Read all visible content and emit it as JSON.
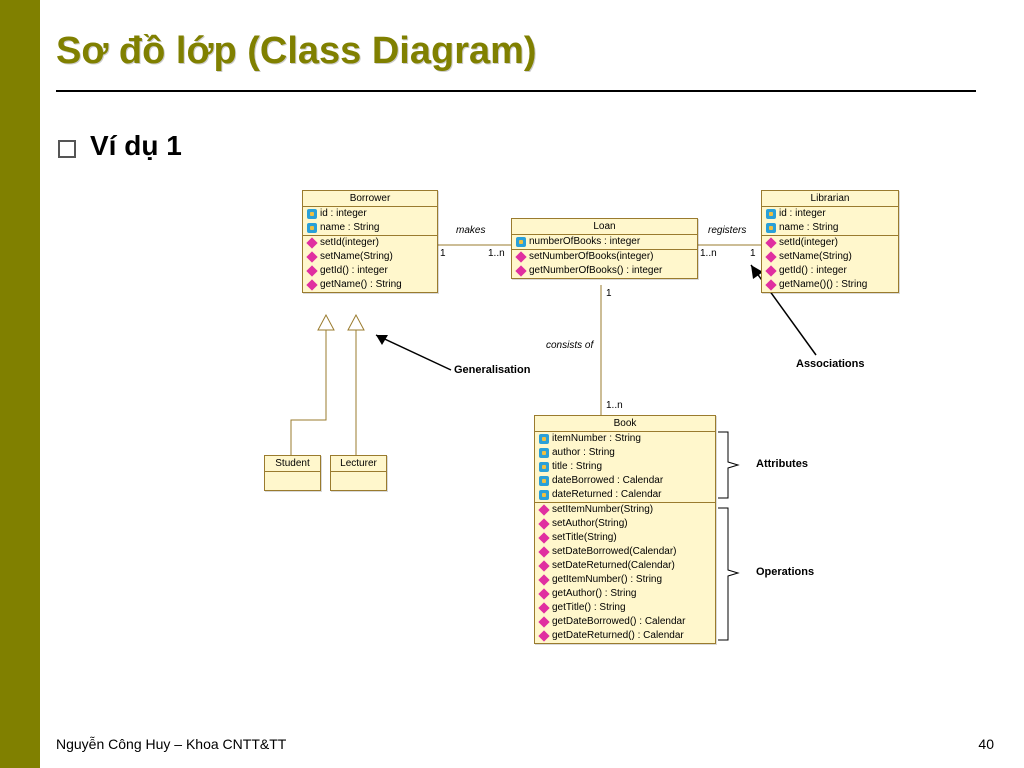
{
  "slide": {
    "title": "Sơ đồ lớp (Class Diagram)",
    "subtitle": "Ví dụ 1",
    "footer_left": "Nguyễn Công Huy – Khoa CNTT&TT",
    "page_number": "40"
  },
  "labels": {
    "makes": "makes",
    "registers": "registers",
    "consists_of": "consists of",
    "generalisation": "Generalisation",
    "associations": "Associations",
    "attributes": "Attributes",
    "operations": "Operations"
  },
  "multiplicities": {
    "borrower_loan_left": "1",
    "borrower_loan_right": "1..n",
    "loan_lib_left": "1..n",
    "loan_lib_right": "1",
    "loan_book_top": "1",
    "loan_book_bottom": "1..n"
  },
  "classes": {
    "borrower": {
      "name": "Borrower",
      "attrs": [
        "id : integer",
        "name : String"
      ],
      "ops": [
        "setId(integer)",
        "setName(String)",
        "getId() : integer",
        "getName() : String"
      ]
    },
    "loan": {
      "name": "Loan",
      "attrs": [
        "numberOfBooks : integer"
      ],
      "ops": [
        "setNumberOfBooks(integer)",
        "getNumberOfBooks() : integer"
      ]
    },
    "librarian": {
      "name": "Librarian",
      "attrs": [
        "id : integer",
        "name : String"
      ],
      "ops": [
        "setId(integer)",
        "setName(String)",
        "getId() : integer",
        "getName()() : String"
      ]
    },
    "book": {
      "name": "Book",
      "attrs": [
        "itemNumber : String",
        "author : String",
        "title : String",
        "dateBorrowed : Calendar",
        "dateReturned : Calendar"
      ],
      "ops": [
        "setItemNumber(String)",
        "setAuthor(String)",
        "setTitle(String)",
        "setDateBorrowed(Calendar)",
        "setDateReturned(Calendar)",
        "getItemNumber() : String",
        "getAuthor() : String",
        "getTitle() : String",
        "getDateBorrowed() : Calendar",
        "getDateReturned() : Calendar"
      ]
    },
    "student": {
      "name": "Student"
    },
    "lecturer": {
      "name": "Lecturer"
    }
  }
}
